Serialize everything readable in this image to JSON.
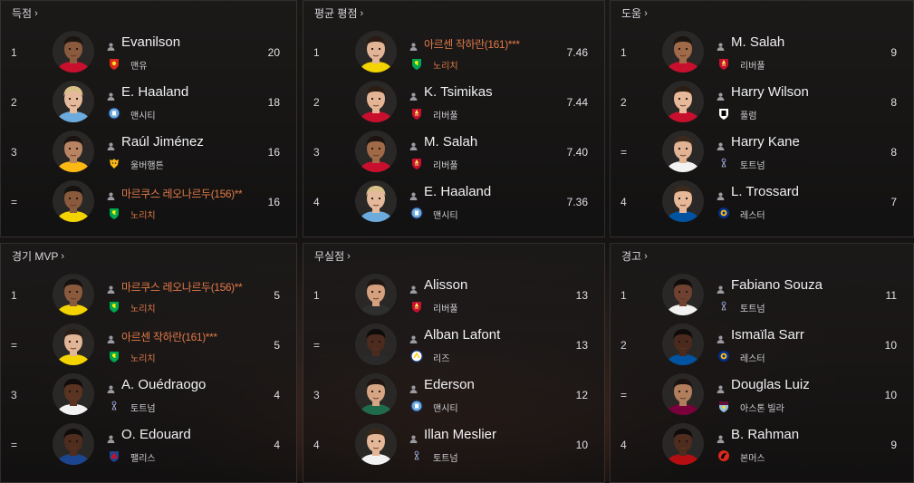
{
  "colors": {
    "accent_foreign": "#e07a48",
    "text": "#f0f0f3",
    "panel_border": "#555555"
  },
  "panels": [
    {
      "title": "득점",
      "rows": [
        {
          "rank": "1",
          "name": "Evanilson",
          "club": "맨유",
          "value": "20",
          "foreign": false,
          "crest": "man-utd-crest",
          "skin": "#8a5a3c",
          "hair": "#1b1411",
          "shirt": "#c8102e"
        },
        {
          "rank": "2",
          "name": "E. Haaland",
          "club": "맨시티",
          "value": "18",
          "foreign": false,
          "crest": "man-city-crest",
          "skin": "#e5b99b",
          "hair": "#d8c089",
          "shirt": "#6cabdd"
        },
        {
          "rank": "3",
          "name": "Raúl Jiménez",
          "club": "울버햄튼",
          "value": "16",
          "foreign": false,
          "crest": "wolves-crest",
          "skin": "#b98462",
          "hair": "#1a1412",
          "shirt": "#fdb913"
        },
        {
          "rank": "=",
          "name": "마르쿠스 레오나르두(156)**",
          "club": "노리치",
          "value": "16",
          "foreign": true,
          "crest": "norwich-crest",
          "skin": "#8a5a3c",
          "hair": "#151110",
          "shirt": "#f4d400"
        }
      ]
    },
    {
      "title": "평균 평점",
      "rows": [
        {
          "rank": "1",
          "name": "아르센 작하란(161)***",
          "club": "노리치",
          "value": "7.46",
          "foreign": true,
          "crest": "norwich-crest",
          "skin": "#e2b596",
          "hair": "#2a1c14",
          "shirt": "#f4d400"
        },
        {
          "rank": "2",
          "name": "K. Tsimikas",
          "club": "리버풀",
          "value": "7.44",
          "foreign": false,
          "crest": "liverpool-crest",
          "skin": "#e4b595",
          "hair": "#2b1d14",
          "shirt": "#c8102e"
        },
        {
          "rank": "3",
          "name": "M. Salah",
          "club": "리버풀",
          "value": "7.40",
          "foreign": false,
          "crest": "liverpool-crest",
          "skin": "#a06a48",
          "hair": "#1b1411",
          "shirt": "#c8102e"
        },
        {
          "rank": "4",
          "name": "E. Haaland",
          "club": "맨시티",
          "value": "7.36",
          "foreign": false,
          "crest": "man-city-crest",
          "skin": "#e5b99b",
          "hair": "#d8c089",
          "shirt": "#6cabdd"
        }
      ]
    },
    {
      "title": "도움",
      "rows": [
        {
          "rank": "1",
          "name": "M. Salah",
          "club": "리버풀",
          "value": "9",
          "foreign": false,
          "crest": "liverpool-crest",
          "skin": "#a06a48",
          "hair": "#1b1411",
          "shirt": "#c8102e"
        },
        {
          "rank": "2",
          "name": "Harry Wilson",
          "club": "풀럼",
          "value": "8",
          "foreign": false,
          "crest": "fulham-crest",
          "skin": "#e7b99a",
          "hair": "#2b1d14",
          "shirt": "#c8102e"
        },
        {
          "rank": "=",
          "name": "Harry Kane",
          "club": "토트넘",
          "value": "8",
          "foreign": false,
          "crest": "tottenham-crest",
          "skin": "#e2b394",
          "hair": "#3b2a1c",
          "shirt": "#f2f2f2"
        },
        {
          "rank": "4",
          "name": "L. Trossard",
          "club": "레스터",
          "value": "7",
          "foreign": false,
          "crest": "leicester-crest",
          "skin": "#e6b898",
          "hair": "#3b2a1c",
          "shirt": "#0053a0"
        }
      ]
    },
    {
      "title": "경기 MVP",
      "rows": [
        {
          "rank": "1",
          "name": "마르쿠스 레오나르두(156)**",
          "club": "노리치",
          "value": "5",
          "foreign": true,
          "crest": "norwich-crest",
          "skin": "#8a5a3c",
          "hair": "#151110",
          "shirt": "#f4d400"
        },
        {
          "rank": "=",
          "name": "아르센 작하란(161)***",
          "club": "노리치",
          "value": "5",
          "foreign": true,
          "crest": "norwich-crest",
          "skin": "#e2b596",
          "hair": "#2a1c14",
          "shirt": "#f4d400"
        },
        {
          "rank": "3",
          "name": "A. Ouédraogo",
          "club": "토트넘",
          "value": "4",
          "foreign": false,
          "crest": "tottenham-crest",
          "skin": "#5a3322",
          "hair": "#110c0b",
          "shirt": "#f2f2f2"
        },
        {
          "rank": "=",
          "name": "O. Edouard",
          "club": "팰리스",
          "value": "4",
          "foreign": false,
          "crest": "palace-crest",
          "skin": "#4e2d1f",
          "hair": "#0f0b0a",
          "shirt": "#1b458f"
        }
      ]
    },
    {
      "title": "무실점",
      "rows": [
        {
          "rank": "1",
          "name": "Alisson",
          "club": "리버풀",
          "value": "13",
          "foreign": false,
          "crest": "liverpool-crest",
          "skin": "#d4a07e",
          "hair": "#1f1611",
          "shirt": "#2f2f2f"
        },
        {
          "rank": "=",
          "name": "Alban Lafont",
          "club": "리즈",
          "value": "13",
          "foreign": false,
          "crest": "leeds-crest",
          "skin": "#4b2b1e",
          "hair": "#0f0b0a",
          "shirt": "#2a2a2a"
        },
        {
          "rank": "3",
          "name": "Ederson",
          "club": "맨시티",
          "value": "12",
          "foreign": false,
          "crest": "man-city-crest",
          "skin": "#d6a584",
          "hair": "#1f1611",
          "shirt": "#1f6b4a"
        },
        {
          "rank": "4",
          "name": "Illan Meslier",
          "club": "토트넘",
          "value": "10",
          "foreign": false,
          "crest": "tottenham-crest",
          "skin": "#e4b798",
          "hair": "#3a2819",
          "shirt": "#f2f2f2"
        }
      ]
    },
    {
      "title": "경고",
      "rows": [
        {
          "rank": "1",
          "name": "Fabiano Souza",
          "club": "토트넘",
          "value": "11",
          "foreign": false,
          "crest": "tottenham-crest",
          "skin": "#6e4130",
          "hair": "#110c0b",
          "shirt": "#f2f2f2"
        },
        {
          "rank": "2",
          "name": "Ismaïla Sarr",
          "club": "레스터",
          "value": "10",
          "foreign": false,
          "crest": "leicester-crest",
          "skin": "#4a2a1c",
          "hair": "#0f0b0a",
          "shirt": "#0053a0"
        },
        {
          "rank": "=",
          "name": "Douglas Luiz",
          "club": "아스톤 빌라",
          "value": "10",
          "foreign": false,
          "crest": "villa-crest",
          "skin": "#b17e5d",
          "hair": "#1a1311",
          "shirt": "#7a003c"
        },
        {
          "rank": "4",
          "name": "B. Rahman",
          "club": "본머스",
          "value": "9",
          "foreign": false,
          "crest": "bournemouth-crest",
          "skin": "#4e2d1f",
          "hair": "#0f0b0a",
          "shirt": "#b50e12"
        }
      ]
    }
  ]
}
